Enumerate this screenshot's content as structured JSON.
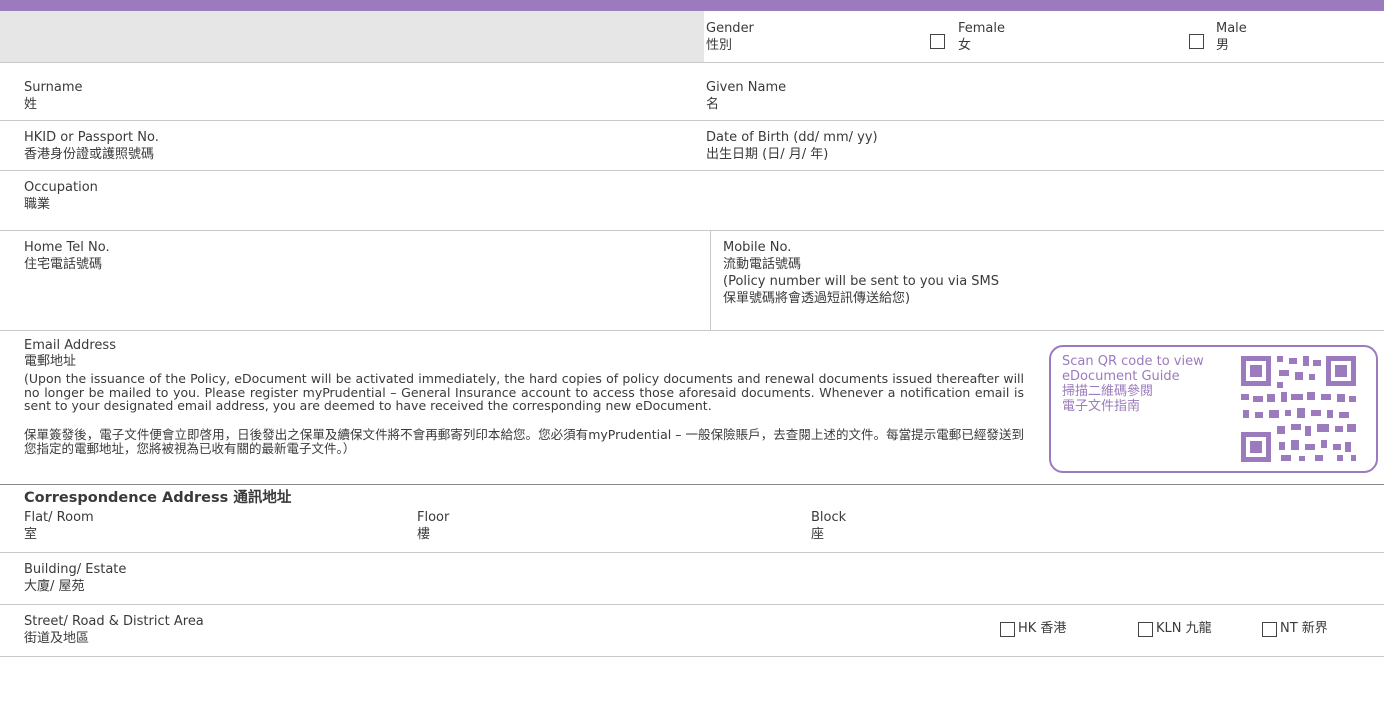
{
  "gender": {
    "label": "Gender",
    "label_zh": "性別",
    "female": "Female",
    "female_zh": "女",
    "male": "Male",
    "male_zh": "男"
  },
  "surname": {
    "label": "Surname",
    "label_zh": "姓"
  },
  "given_name": {
    "label": "Given Name",
    "label_zh": "名"
  },
  "hkid": {
    "label": "HKID or Passport No.",
    "label_zh": "香港身份證或護照號碼"
  },
  "dob": {
    "label": "Date of Birth (dd/ mm/ yy)",
    "label_zh": "出生日期 (日/ 月/ 年)"
  },
  "occupation": {
    "label": "Occupation",
    "label_zh": "職業"
  },
  "home_tel": {
    "label": "Home Tel No.",
    "label_zh": "住宅電話號碼"
  },
  "mobile": {
    "label": "Mobile No.",
    "label_zh": "流動電話號碼",
    "note": "(Policy number will be sent to you via SMS",
    "note_zh": "保單號碼將會透過短訊傳送給您)"
  },
  "email": {
    "label": "Email Address",
    "label_zh": "電郵地址",
    "note_en": "(Upon the issuance of the Policy, eDocument will be activated immediately, the hard copies of policy documents and renewal documents issued thereafter will no longer be mailed to you. Please register myPrudential – General Insurance account to access those aforesaid documents.  Whenever a notification email is sent to your designated email address, you are deemed to have received the corresponding new eDocument.",
    "note_zh": "保單簽發後，電子文件便會立即啓用，日後發出之保單及續保文件將不會再郵寄列印本給您。您必須有myPrudential – 一般保險賬戶，去查閱上述的文件。每當提示電郵已經發送到您指定的電郵地址，您將被視為已收有關的最新電子文件。）"
  },
  "qr": {
    "text": "Scan QR code to view\neDocument Guide\n掃描二維碼參閱\n電子文件指南"
  },
  "address": {
    "heading": "Correspondence Address 通訊地址",
    "flat": "Flat/ Room",
    "flat_zh": "室",
    "floor": "Floor",
    "floor_zh": "樓",
    "block": "Block",
    "block_zh": "座",
    "building": "Building/ Estate",
    "building_zh": "大廈/ 屋苑",
    "street": "Street/ Road & District Area",
    "street_zh": "街道及地區",
    "hk": "HK 香港",
    "kln": "KLN 九龍",
    "nt": "NT 新界"
  },
  "colors": {
    "accent": "#9b7bbd",
    "shade": "#e6e6e6"
  }
}
